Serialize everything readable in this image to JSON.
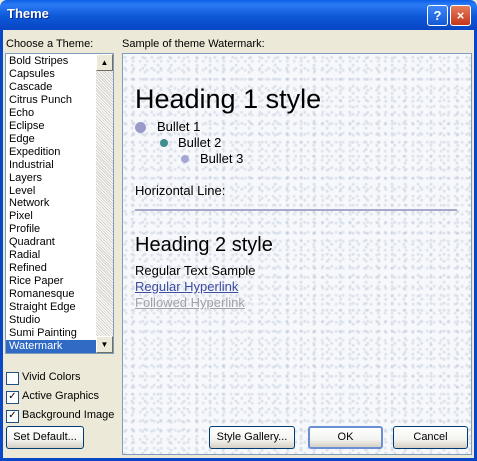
{
  "window": {
    "title": "Theme",
    "help": "?",
    "close": "×"
  },
  "left_panel": {
    "label": "Choose a Theme:",
    "themes": [
      "Bold Stripes",
      "Capsules",
      "Cascade",
      "Citrus Punch",
      "Echo",
      "Eclipse",
      "Edge",
      "Expedition",
      "Industrial",
      "Layers",
      "Level",
      "Network",
      "Pixel",
      "Profile",
      "Quadrant",
      "Radial",
      "Refined",
      "Rice Paper",
      "Romanesque",
      "Straight Edge",
      "Studio",
      "Sumi Painting",
      "Watermark"
    ],
    "selected": "Watermark",
    "scroll_up": "▲",
    "scroll_down": "▼"
  },
  "preview": {
    "label": "Sample of theme Watermark:",
    "heading1": "Heading 1 style",
    "bullets": [
      "Bullet 1",
      "Bullet 2",
      "Bullet 3"
    ],
    "hr_label": "Horizontal Line:",
    "heading2": "Heading 2 style",
    "body": "Regular Text Sample",
    "link": "Regular Hyperlink",
    "followed_link": "Followed Hyperlink"
  },
  "options": [
    {
      "label": "Vivid Colors",
      "checked": false
    },
    {
      "label": "Active Graphics",
      "checked": true
    },
    {
      "label": "Background Image",
      "checked": true
    }
  ],
  "buttons": {
    "set_default": "Set Default...",
    "style_gallery": "Style Gallery...",
    "ok": "OK",
    "cancel": "Cancel"
  },
  "colors": {
    "bullet1": "#9a9acb",
    "bullet2": "#3e8e8e",
    "bullet3": "#a6a6d6",
    "link": "#3c4ca0",
    "followed": "#a0a0a8"
  }
}
